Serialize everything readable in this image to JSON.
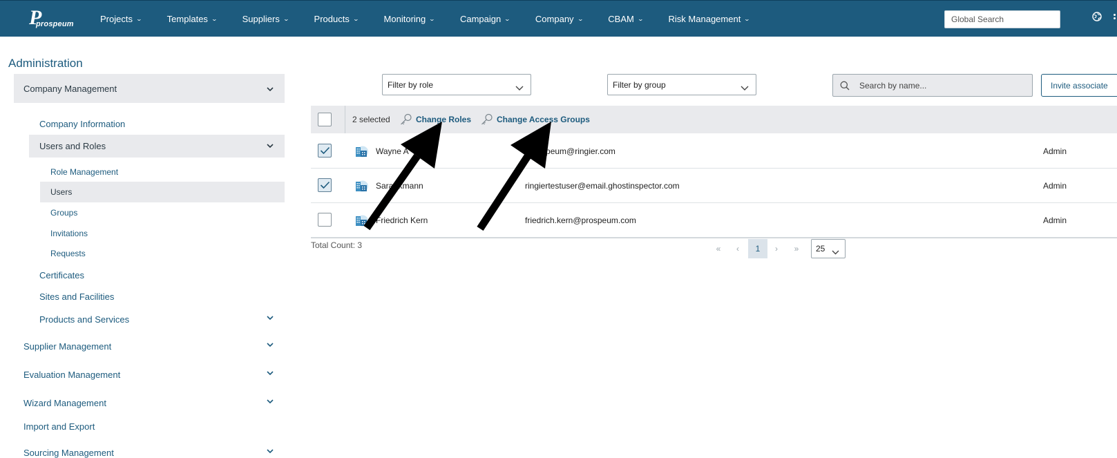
{
  "brand": {
    "logo_letter": "P",
    "logo_word": "prospeum"
  },
  "nav": {
    "items": [
      {
        "label": "Projects"
      },
      {
        "label": "Templates"
      },
      {
        "label": "Suppliers"
      },
      {
        "label": "Products"
      },
      {
        "label": "Monitoring"
      },
      {
        "label": "Campaign"
      },
      {
        "label": "Company"
      },
      {
        "label": "CBAM"
      },
      {
        "label": "Risk Management"
      }
    ],
    "global_search_placeholder": "Global Search"
  },
  "sidebar": {
    "title": "Administration",
    "section": "Company Management",
    "company_information": "Company Information",
    "users_and_roles": "Users and Roles",
    "role_management": "Role Management",
    "users": "Users",
    "groups": "Groups",
    "invitations": "Invitations",
    "requests": "Requests",
    "certificates": "Certificates",
    "sites_and_facilities": "Sites and Facilities",
    "products_and_services": "Products and Services",
    "supplier_management": "Supplier Management",
    "evaluation_management": "Evaluation Management",
    "wizard_management": "Wizard Management",
    "import_and_export": "Import and Export",
    "sourcing_management": "Sourcing Management"
  },
  "filters": {
    "role": "Filter by role",
    "group": "Filter by group",
    "search_placeholder": "Search by name...",
    "invite_label": "Invite associate"
  },
  "table": {
    "selected_text": "2 selected",
    "change_roles": "Change Roles",
    "change_access_groups": "Change Access Groups",
    "rows": [
      {
        "name": "Wayne A",
        "email": "_prospeum@ringier.com",
        "role": "Admin",
        "checked": true
      },
      {
        "name": "Sara rkmann",
        "email": "ringiertestuser@email.ghostinspector.com",
        "role": "Admin",
        "checked": true
      },
      {
        "name": "Friedrich Kern",
        "email": "friedrich.kern@prospeum.com",
        "role": "Admin",
        "checked": false
      }
    ]
  },
  "pagination": {
    "total_count": "Total Count: 3",
    "first": "«",
    "prev": "‹",
    "current": "1",
    "next": "›",
    "last": "»",
    "page_size": "25"
  },
  "colors": {
    "primary": "#1d5b7e",
    "row_highlight": "#e9eaed"
  }
}
